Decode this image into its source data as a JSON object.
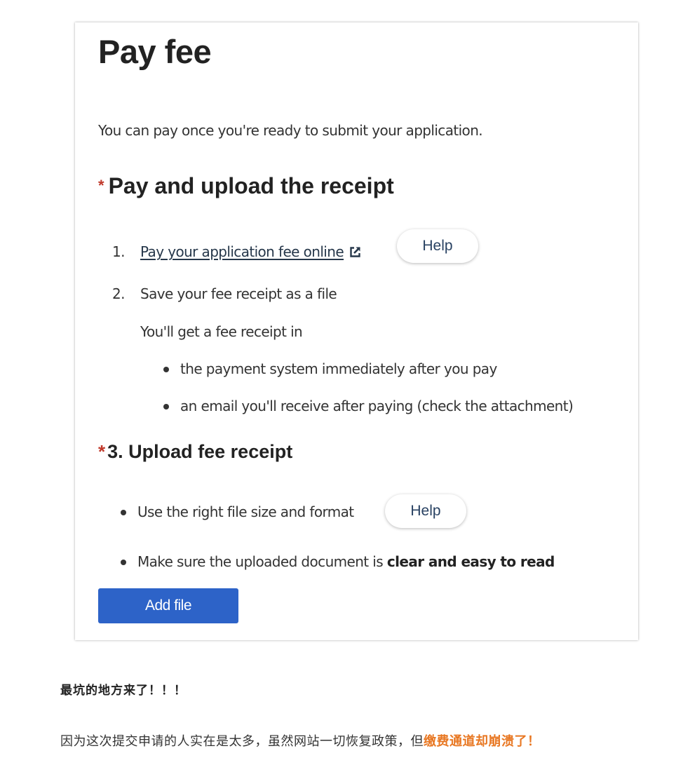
{
  "form": {
    "title": "Pay fee",
    "intro": "You can pay once you're ready to submit your application.",
    "required_mark": "*",
    "section_heading": "Pay and upload the receipt",
    "steps": [
      {
        "number": "1.",
        "link_text": "Pay your application fee online",
        "help_label": "Help",
        "icon": "external-link-icon"
      },
      {
        "number": "2.",
        "text": "Save your fee receipt as a file"
      }
    ],
    "receipt_info": "You'll get a fee receipt in",
    "receipt_sources": [
      "the payment system immediately after you pay",
      "an email you'll receive after paying (check the attachment)"
    ],
    "upload_heading": "3. Upload fee receipt",
    "upload_tips": {
      "size_format": "Use the right file size and format",
      "size_format_help": "Help",
      "clear_prefix": "Make sure the uploaded document is ",
      "clear_bold": "clear and easy to read"
    },
    "add_file_label": "Add file"
  },
  "article": {
    "bold_line": "最坑的地方来了！！！",
    "paragraph_prefix": "因为这次提交申请的人实在是太多，虽然网站一切恢复政策，但",
    "paragraph_highlight": "缴费通道却崩溃了！"
  },
  "colors": {
    "button_blue": "#2d63c8",
    "required_red": "#c0392b",
    "highlight_orange": "#e87722",
    "link_navy": "#26374a"
  }
}
